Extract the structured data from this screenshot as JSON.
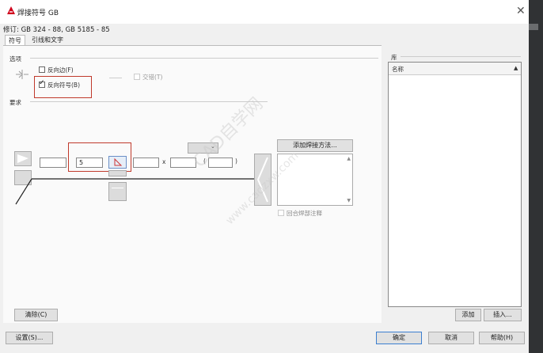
{
  "window": {
    "title": "焊接符号 GB",
    "close_glyph": "✕"
  },
  "revision": "修订: GB 324 - 88, GB 5185 - 85",
  "tabs": [
    {
      "label": "符号"
    },
    {
      "label": "引线和文字"
    }
  ],
  "options": {
    "section_label": "选项",
    "reverse_side": "反向边(F)",
    "reverse_symbol": "反向符号(B)",
    "stagger": "交错(T)"
  },
  "require_label": "要求",
  "fields": {
    "value": "5",
    "times": "x",
    "paren_open": "(",
    "paren_close": ")"
  },
  "add_method_button": "添加焊接方法...",
  "loop_weld_label": "回合焊部注释",
  "library": {
    "section_label": "库",
    "col_name": "名称"
  },
  "buttons": {
    "clear": "清除(C)",
    "add": "添加",
    "insert": "插入...",
    "settings": "设置(S)...",
    "ok": "确定",
    "cancel": "取消",
    "help": "帮助(H)"
  },
  "watermark": {
    "line1": "CAD自学网",
    "line2": "www.cadzxw.com"
  }
}
